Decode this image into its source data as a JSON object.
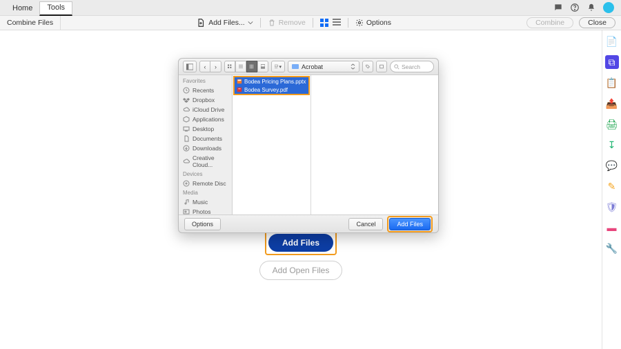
{
  "top_tabs": {
    "home": "Home",
    "tools": "Tools"
  },
  "topbar_icons": {
    "chat": "chat-bubble-icon",
    "help": "help-icon",
    "bell": "bell-icon",
    "avatar": "user-avatar"
  },
  "sub": {
    "title": "Combine Files",
    "add_files": "Add Files...",
    "remove": "Remove",
    "options": "Options",
    "combine": "Combine",
    "close": "Close"
  },
  "prompt": {
    "add_files": "Add Files",
    "add_open": "Add Open Files"
  },
  "dialog": {
    "location": "Acrobat",
    "search_placeholder": "Search",
    "sidebar": {
      "favorites_hdr": "Favorites",
      "devices_hdr": "Devices",
      "media_hdr": "Media",
      "favorites": [
        "Recents",
        "Dropbox",
        "iCloud Drive",
        "Applications",
        "Desktop",
        "Documents",
        "Downloads",
        "Creative Cloud..."
      ],
      "devices": [
        "Remote Disc"
      ],
      "media": [
        "Music",
        "Photos"
      ]
    },
    "files": [
      {
        "name": "Bodea Pricing Plans.pptx",
        "icon": "presentation-file-icon"
      },
      {
        "name": "Bodea Survey.pdf",
        "icon": "pdf-file-icon"
      }
    ],
    "options": "Options",
    "cancel": "Cancel",
    "add_files": "Add Files"
  },
  "rail": {
    "icons": [
      {
        "name": "create-pdf-icon",
        "glyph": "📄",
        "color": "#e8467c"
      },
      {
        "name": "combine-files-icon",
        "glyph": "⧉",
        "color": "#5247e5",
        "selected": true
      },
      {
        "name": "form-icon",
        "glyph": "📋",
        "color": "#e8467c"
      },
      {
        "name": "export-icon",
        "glyph": "📤",
        "color": "#17a34a"
      },
      {
        "name": "scan-icon",
        "glyph": "🖨",
        "color": "#17a34a"
      },
      {
        "name": "organize-icon",
        "glyph": "↧",
        "color": "#22b573"
      },
      {
        "name": "comment-icon",
        "glyph": "💬",
        "color": "#f5c518"
      },
      {
        "name": "sign-icon",
        "glyph": "✎",
        "color": "#f5a623"
      },
      {
        "name": "protect-icon",
        "glyph": "🛡",
        "color": "#7c7cd6"
      },
      {
        "name": "redact-icon",
        "glyph": "▬",
        "color": "#e8467c"
      },
      {
        "name": "more-tools-icon",
        "glyph": "🔧",
        "color": "#8a8a8a"
      }
    ]
  }
}
